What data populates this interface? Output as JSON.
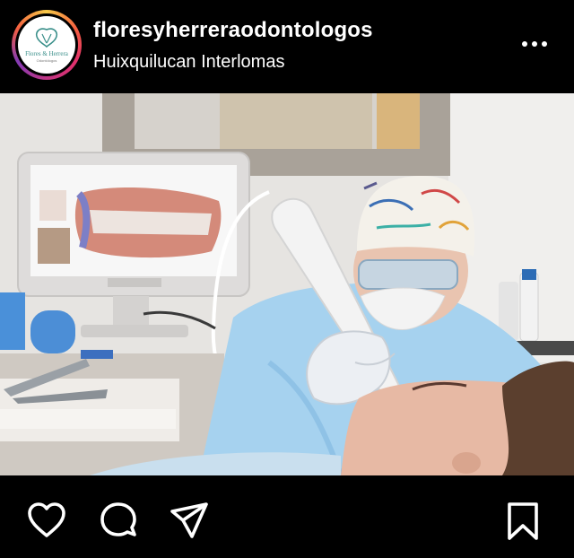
{
  "post": {
    "username": "floresyherreraodontologos",
    "location": "Huixquilucan Interlomas",
    "avatar_text": "Flores & Herrera",
    "avatar_subtext": "Odontólogos"
  },
  "icons": {
    "more": "more-options-icon",
    "like": "heart-icon",
    "comment": "comment-icon",
    "share": "send-icon",
    "save": "bookmark-icon"
  },
  "colors": {
    "background": "#000000",
    "text": "#ffffff",
    "story_ring_start": "#f7c948",
    "story_ring_end": "#833ab4"
  }
}
